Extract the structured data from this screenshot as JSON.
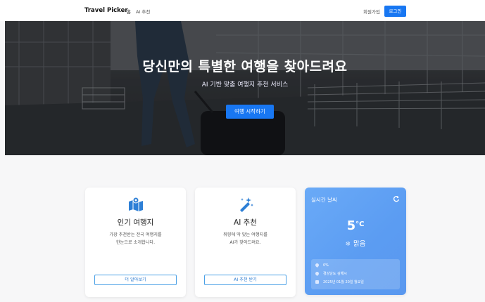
{
  "nav": {
    "brand": "Travel Picker",
    "links": [
      "홈",
      "AI 추천"
    ],
    "signup": "회원가입",
    "login": "로그인"
  },
  "hero": {
    "title": "당신만의 특별한 여행을 찾아드려요",
    "subtitle": "AI 기반 맞춤 여행지 추천 서비스",
    "cta": "여행 시작하기"
  },
  "cards": [
    {
      "icon": "map-icon",
      "title": "인기 여행지",
      "desc_line1": "가장 추천받는 전국 여행지를",
      "desc_line2": "한눈으로 소개합니다.",
      "button": "더 알아보기"
    },
    {
      "icon": "magic-wand-icon",
      "title": "AI 추천",
      "desc_line1": "취향에 딱 맞는 여행지를",
      "desc_line2": "AI가 찾아드려요.",
      "button": "AI 추천 받기"
    }
  ],
  "weather": {
    "title": "실시간 날씨",
    "temp": "5",
    "unit": "°C",
    "condition": "맑음",
    "humidity": "0%",
    "location": "경상남도 김해시",
    "date": "2025년 01월 20일 월요일",
    "colors": {
      "accent": "#5b9cf2"
    }
  },
  "colors": {
    "primary": "#1877f2",
    "outline": "#4aa0e6"
  }
}
